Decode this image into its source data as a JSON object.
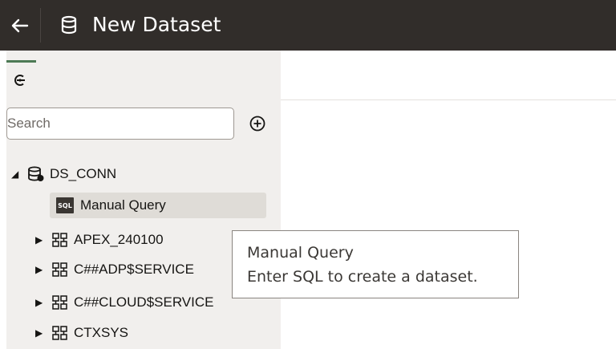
{
  "header": {
    "back_icon": "arrow-left-icon",
    "dataset_icon": "database-icon",
    "title": "New Dataset"
  },
  "side_panel": {
    "tab_icon": "connection-icon",
    "search": {
      "placeholder": "Search",
      "value": ""
    },
    "add_icon": "plus-circle-icon",
    "tree": {
      "connection": {
        "label": "DS_CONN",
        "icon": "database-connection-icon",
        "expanded": true
      },
      "manual_query": {
        "badge": "SQL",
        "label": "Manual Query"
      },
      "schemas": [
        {
          "label": "APEX_240100",
          "icon": "schema-icon"
        },
        {
          "label": "C##ADP$SERVICE",
          "icon": "schema-icon"
        },
        {
          "label": "C##CLOUD$SERVICE",
          "icon": "schema-icon"
        },
        {
          "label": "CTXSYS",
          "icon": "schema-icon"
        }
      ]
    }
  },
  "tooltip": {
    "title": "Manual Query",
    "text": "Enter SQL to create a dataset."
  },
  "colors": {
    "header_bg": "#312d2a",
    "panel_bg": "#f1efed",
    "selected_row": "#dfdcd7",
    "tab_indicator": "#4d7a55"
  }
}
